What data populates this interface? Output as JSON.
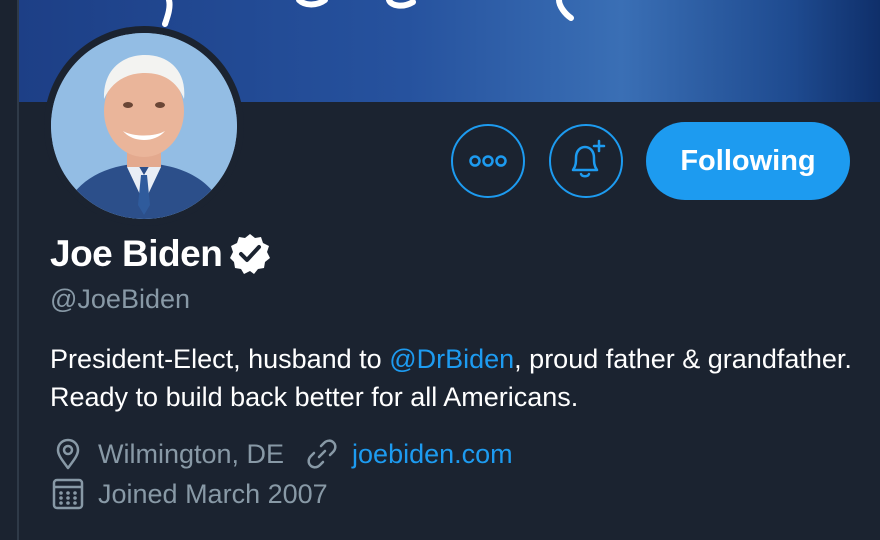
{
  "profile": {
    "name": "Joe Biden",
    "handle": "@JoeBiden",
    "verified": true,
    "bio": {
      "before": "President-Elect, husband to ",
      "mention": "@DrBiden",
      "after": ", proud father & grandfather. Ready to build back better for all Americans."
    },
    "location": "Wilmington, DE",
    "website": "joebiden.com",
    "joined": "Joined March 2007"
  },
  "actions": {
    "more_icon": "more-dots-icon",
    "notify_icon": "bell-plus-icon",
    "follow_label": "Following"
  },
  "icons": {
    "location": "location-pin-icon",
    "website": "link-icon",
    "joined": "calendar-icon",
    "verified": "verified-badge-icon"
  },
  "colors": {
    "background": "#1b2330",
    "accent": "#1d9bf0",
    "secondary_text": "#8899a6",
    "primary_text": "#ffffff",
    "banner": "#26529e"
  }
}
